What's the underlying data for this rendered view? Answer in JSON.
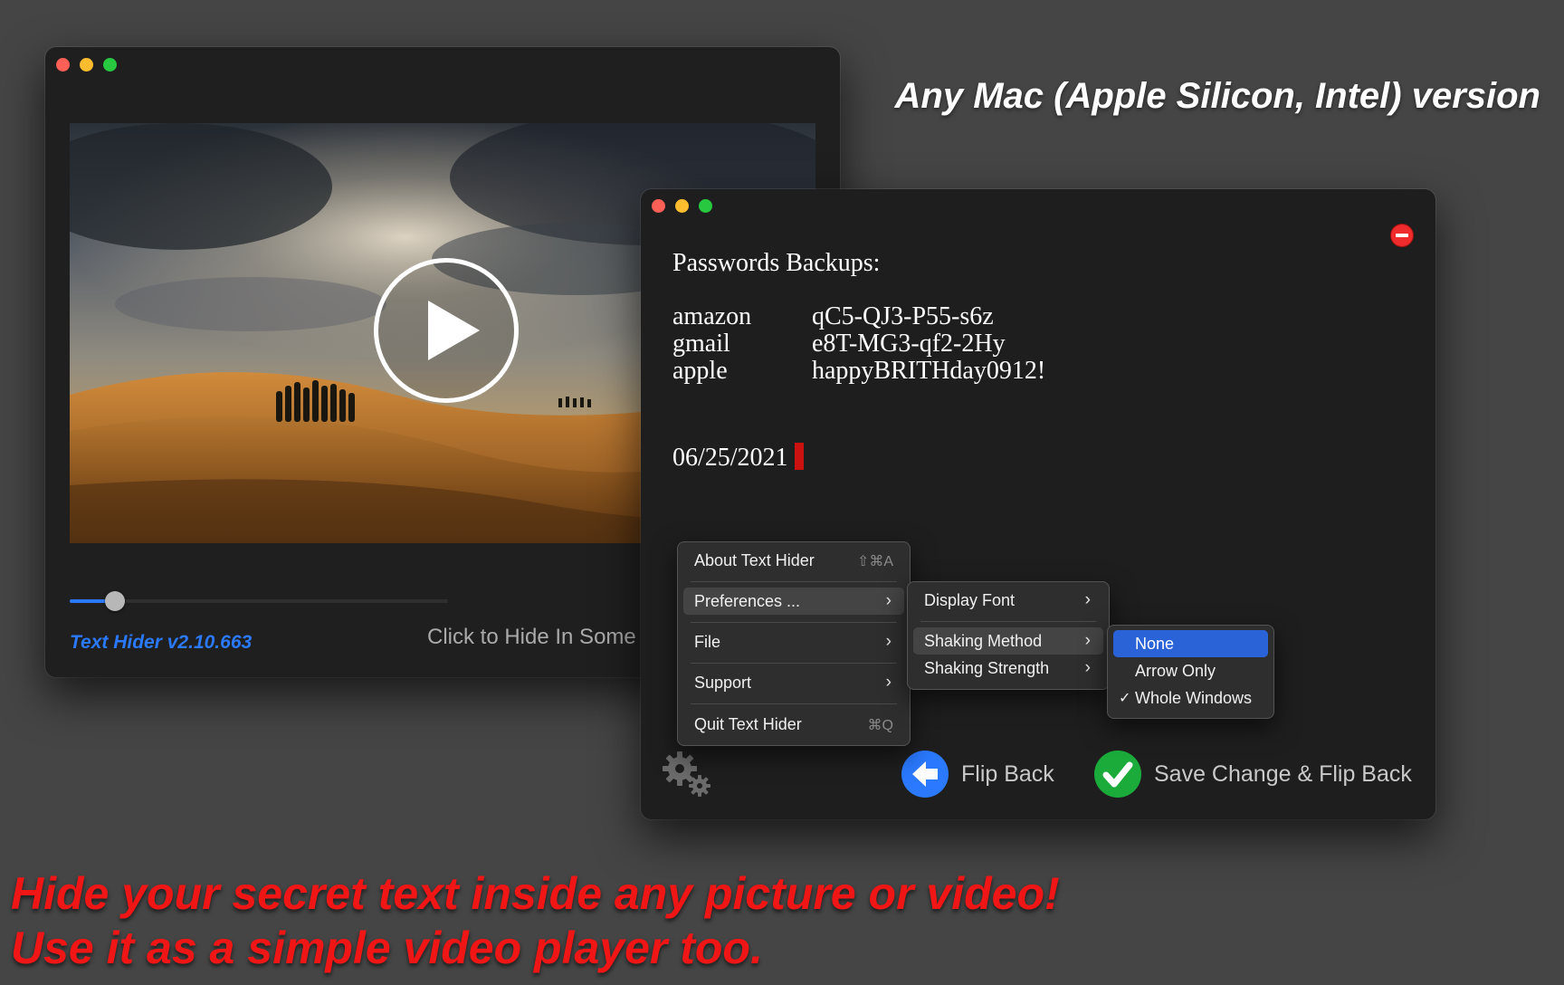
{
  "headline": "Any Mac (Apple Silicon, Intel) version",
  "tagline": {
    "line1": "Hide your secret text inside any picture or video!",
    "line2": "Use it as a simple video player too."
  },
  "colors": {
    "tagline": "#f11616",
    "accent_blue": "#2a79ff",
    "menu_selected": "#2a63d8",
    "check_green": "#1bab3b",
    "remove_red": "#ef2b2b"
  },
  "player_window": {
    "version_label": "Text Hider v2.10.663",
    "hint": "Click to Hide In Some",
    "progress": 0.12,
    "play_icon": "play-icon"
  },
  "note_window": {
    "title": "Passwords Backups:",
    "entries": [
      {
        "service": "amazon",
        "password": "qC5-QJ3-P55-s6z"
      },
      {
        "service": "gmail",
        "password": "e8T-MG3-qf2-2Hy"
      },
      {
        "service": "apple",
        "password": "happyBRITHday0912!"
      }
    ],
    "date": "06/25/2021",
    "flip_back": "Flip Back",
    "save_flip_back": "Save Change & Flip Back"
  },
  "main_menu": {
    "items": [
      {
        "label": "About Text Hider",
        "shortcut": "⇧⌘A"
      },
      {
        "label": "Preferences ...",
        "submenu": true
      },
      {
        "label": "File",
        "submenu": true
      },
      {
        "label": "Support",
        "submenu": true
      },
      {
        "label": "Quit Text Hider",
        "shortcut": "⌘Q"
      }
    ]
  },
  "preferences_menu": {
    "items": [
      {
        "label": "Display Font"
      },
      {
        "label": "Shaking Method"
      },
      {
        "label": "Shaking Strength"
      }
    ]
  },
  "shaking_menu": {
    "items": [
      {
        "label": "None",
        "selected": true
      },
      {
        "label": "Arrow Only"
      },
      {
        "label": "Whole Windows",
        "checked": true
      }
    ],
    "check_mark": "✓"
  }
}
